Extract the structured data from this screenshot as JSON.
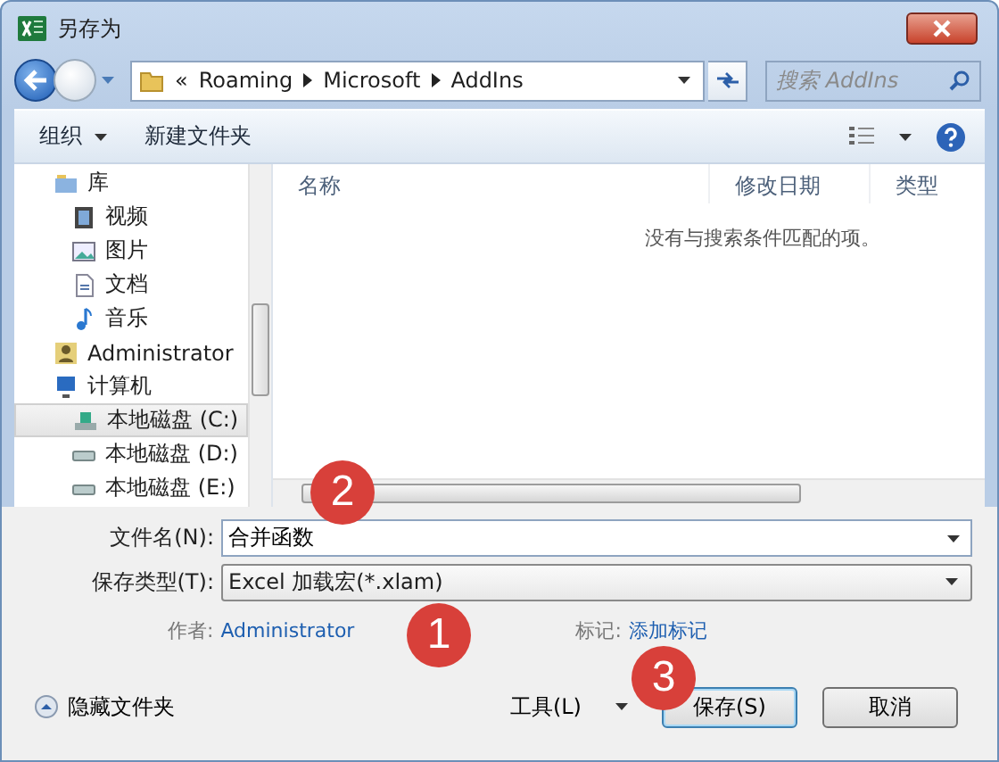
{
  "window": {
    "title": "另存为"
  },
  "address": {
    "breadcrumbs": [
      "«",
      "Roaming",
      "Microsoft",
      "AddIns"
    ]
  },
  "search": {
    "placeholder": "搜索 AddIns"
  },
  "toolbar": {
    "organize": "组织",
    "new_folder": "新建文件夹"
  },
  "sidebar": {
    "items": [
      {
        "label": "库",
        "kind": "library",
        "selected": false,
        "children": [
          {
            "label": "视频",
            "kind": "video",
            "selected": false
          },
          {
            "label": "图片",
            "kind": "picture",
            "selected": false
          },
          {
            "label": "文档",
            "kind": "document",
            "selected": false
          },
          {
            "label": "音乐",
            "kind": "music",
            "selected": false
          }
        ]
      },
      {
        "label": "Administrator",
        "kind": "user",
        "selected": false
      },
      {
        "label": "计算机",
        "kind": "computer",
        "selected": false,
        "children": [
          {
            "label": "本地磁盘 (C:)",
            "kind": "system-drive",
            "selected": true
          },
          {
            "label": "本地磁盘 (D:)",
            "kind": "drive",
            "selected": false
          },
          {
            "label": "本地磁盘 (E:)",
            "kind": "drive",
            "selected": false
          }
        ]
      }
    ]
  },
  "file_list": {
    "columns": [
      "名称",
      "修改日期",
      "类型"
    ],
    "empty_message": "没有与搜索条件匹配的项。"
  },
  "form": {
    "filename_label": "文件名(N):",
    "filename_value": "合并函数",
    "type_label": "保存类型(T):",
    "type_value": "Excel 加载宏(*.xlam)",
    "author_label": "作者:",
    "author_value": "Administrator",
    "tags_label": "标记:",
    "tags_value": "添加标记"
  },
  "footer": {
    "hide_folders": "隐藏文件夹",
    "tools": "工具(L)",
    "save": "保存(S)",
    "cancel": "取消"
  },
  "annotations": [
    {
      "label": "1"
    },
    {
      "label": "2"
    },
    {
      "label": "3"
    }
  ]
}
